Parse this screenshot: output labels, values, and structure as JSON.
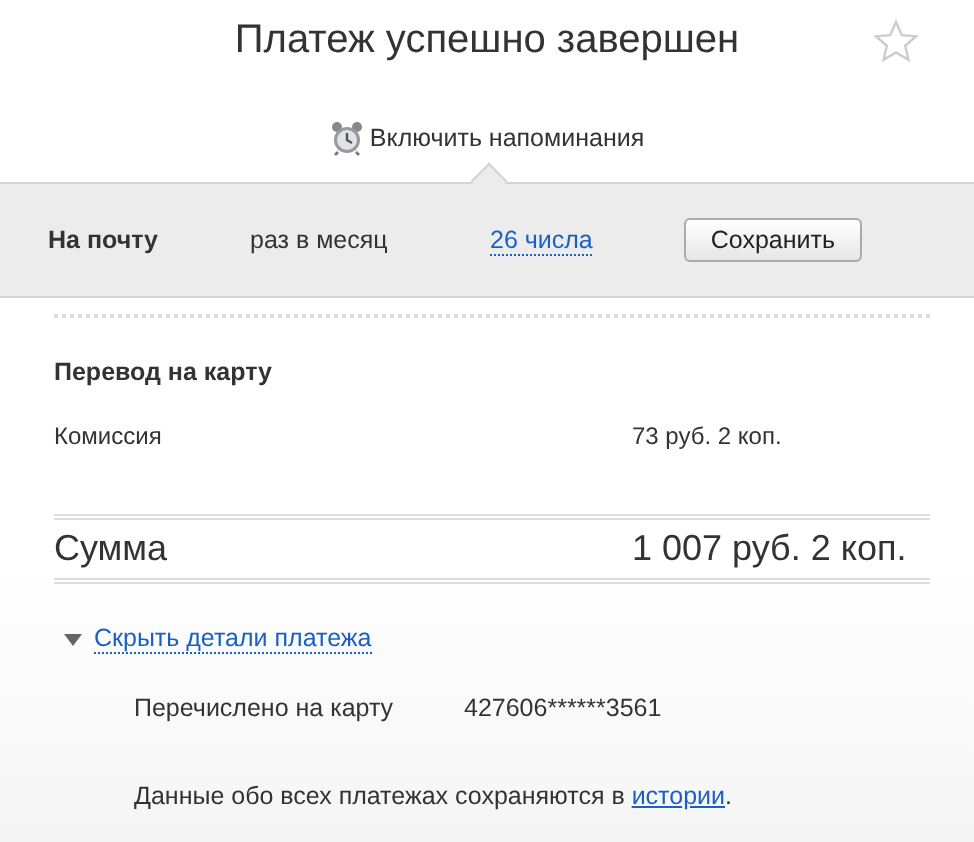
{
  "title": "Платеж успешно завершен",
  "reminder": {
    "label": "Включить напоминания"
  },
  "schedule": {
    "channel": "На почту",
    "frequency": "раз в месяц",
    "day": "26 числа",
    "save": "Сохранить"
  },
  "section_title": "Перевод на карту",
  "fee": {
    "label": "Комиссия",
    "value": "73 руб. 2 коп."
  },
  "total": {
    "label": "Сумма",
    "value": "1 007 руб. 2 коп."
  },
  "details": {
    "toggle": "Скрыть детали платежа",
    "expanded": true,
    "rows": [
      {
        "label": "Перечислено на карту",
        "value": "427606******3561"
      }
    ]
  },
  "footnote": {
    "before": "Данные обо всех платежах сохраняются в ",
    "link": "истории",
    "after": "."
  }
}
